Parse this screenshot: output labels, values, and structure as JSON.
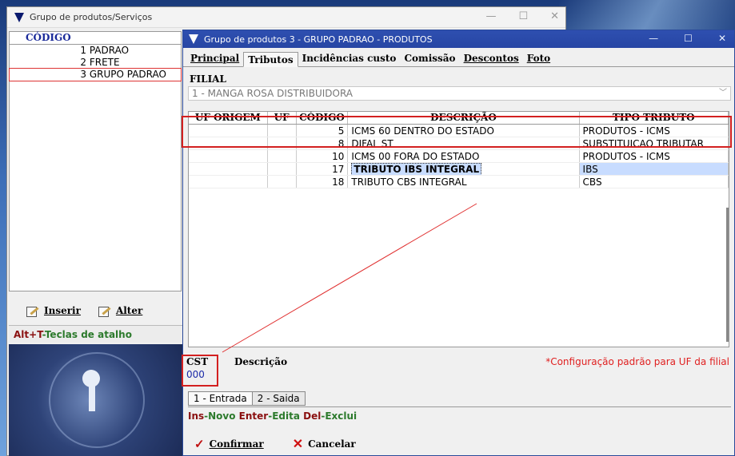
{
  "bg_window": {
    "title": "Grupo de produtos/Serviços",
    "list_header": "CÓDIGO",
    "rows": [
      {
        "code": "1",
        "name": "PADRAO"
      },
      {
        "code": "2",
        "name": "FRETE"
      },
      {
        "code": "3",
        "name": "GRUPO PADRAO"
      }
    ],
    "insert_label": "Inserir",
    "alter_label": "Alter",
    "shortcut_key": "Alt+T",
    "shortcut_text": "-Teclas de atalho"
  },
  "window": {
    "title": "Grupo de produtos 3 - GRUPO PADRAO - PRODUTOS",
    "tabs": [
      "Principal",
      "Tributos",
      "Incidências custo",
      "Comissão",
      "Descontos",
      "Foto"
    ],
    "filial_label": "FILIAL",
    "filial_value": "1 - MANGA ROSA DISTRIBUIDORA",
    "columns": [
      "UF ORIGEM",
      "UF",
      "CÓDIGO",
      "DESCRIÇÃO",
      "TIPO TRIBUTO"
    ],
    "rows": [
      {
        "uf_origem": "",
        "uf": "",
        "codigo": "5",
        "descricao": "ICMS 60 DENTRO DO ESTADO",
        "tipo": "PRODUTOS - ICMS"
      },
      {
        "uf_origem": "",
        "uf": "",
        "codigo": "8",
        "descricao": "DIFAL ST",
        "tipo": "SUBSTITUICAO TRIBUTAR"
      },
      {
        "uf_origem": "",
        "uf": "",
        "codigo": "10",
        "descricao": "ICMS 00 FORA DO ESTADO",
        "tipo": "PRODUTOS - ICMS"
      },
      {
        "uf_origem": "",
        "uf": "",
        "codigo": "17",
        "descricao": "TRIBUTO IBS INTEGRAL",
        "tipo": "IBS"
      },
      {
        "uf_origem": "",
        "uf": "",
        "codigo": "18",
        "descricao": "TRIBUTO CBS INTEGRAL",
        "tipo": "CBS"
      }
    ],
    "cst_label": "CST",
    "cst_value": "000",
    "descricao_label": "Descrição",
    "config_note": "*Configuração padrão para UF da filial",
    "subtabs": [
      "1 - Entrada",
      "2 - Saida"
    ],
    "hint": {
      "k1": "Ins",
      "t1": "-Novo ",
      "k2": "Enter",
      "t2": "-Edita ",
      "k3": "Del",
      "t3": "-Exclui"
    },
    "confirm_label": "Confirmar",
    "cancel_label": "Cancelar"
  }
}
